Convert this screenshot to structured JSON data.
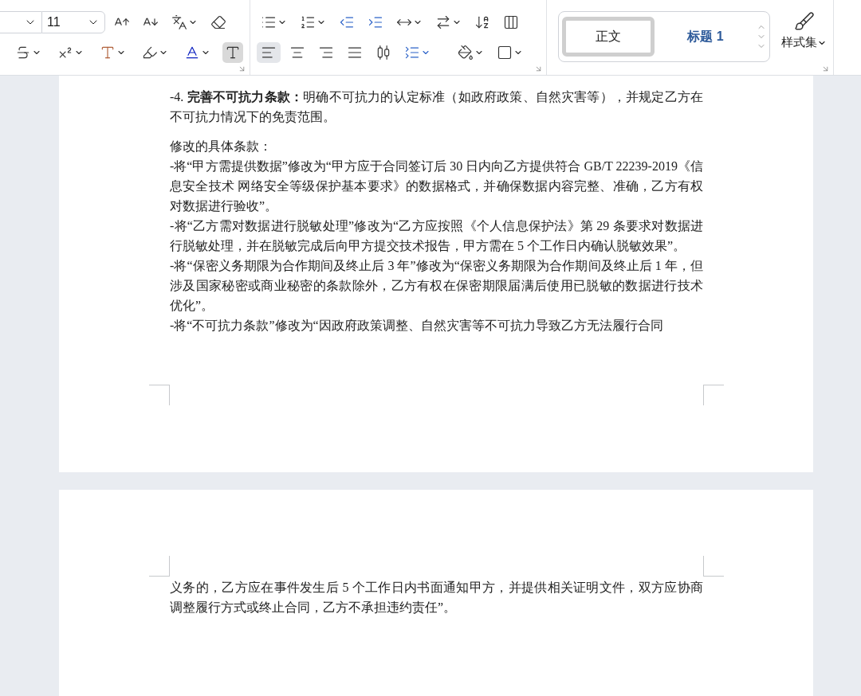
{
  "toolbar": {
    "font_size": "11",
    "align_buttons": [
      {
        "kind": "left",
        "selected": true
      },
      {
        "kind": "center",
        "selected": false
      },
      {
        "kind": "right",
        "selected": false
      },
      {
        "kind": "justify",
        "selected": false
      },
      {
        "kind": "distributed",
        "selected": false
      }
    ],
    "styles": [
      {
        "kind": "body",
        "label": "正文",
        "selected": true
      },
      {
        "kind": "heading",
        "label": "标题 1",
        "selected": false
      }
    ],
    "style_set": "样式集"
  },
  "pages": [
    {
      "paragraphs": [
        "-4. **完善不可抗力条款：**明确不可抗力的认定标准（如政府政策、自然灾害等），并规定乙方在不可抗力情况下的免责范围。",
        "修改的具体条款：",
        "-将“甲方需提供数据”修改为“甲方应于合同签订后 30 日内向乙方提供符合 GB/T 22239-2019《信息安全技术 网络安全等级保护基本要求》的数据格式，并确保数据内容完整、准确，乙方有权对数据进行验收”。",
        "-将“乙方需对数据进行脱敏处理”修改为“乙方应按照《个人信息保护法》第 29 条要求对数据进行脱敏处理，并在脱敏完成后向甲方提交技术报告，甲方需在 5 个工作日内确认脱敏效果”。",
        "-将“保密义务期限为合作期间及终止后 3 年”修改为“保密义务期限为合作期间及终止后 1 年，但涉及国家秘密或商业秘密的条款除外，乙方有权在保密期限届满后使用已脱敏的数据进行技术优化”。",
        "-将“不可抗力条款”修改为“因政府政策调整、自然灾害等不可抗力导致乙方无法履行合同"
      ]
    },
    {
      "paragraphs": [
        "义务的，乙方应在事件发生后 5 个工作日内书面通知甲方，并提供相关证明文件，双方应协商调整履行方式或终止合同，乙方不承担违约责任”。"
      ]
    }
  ]
}
